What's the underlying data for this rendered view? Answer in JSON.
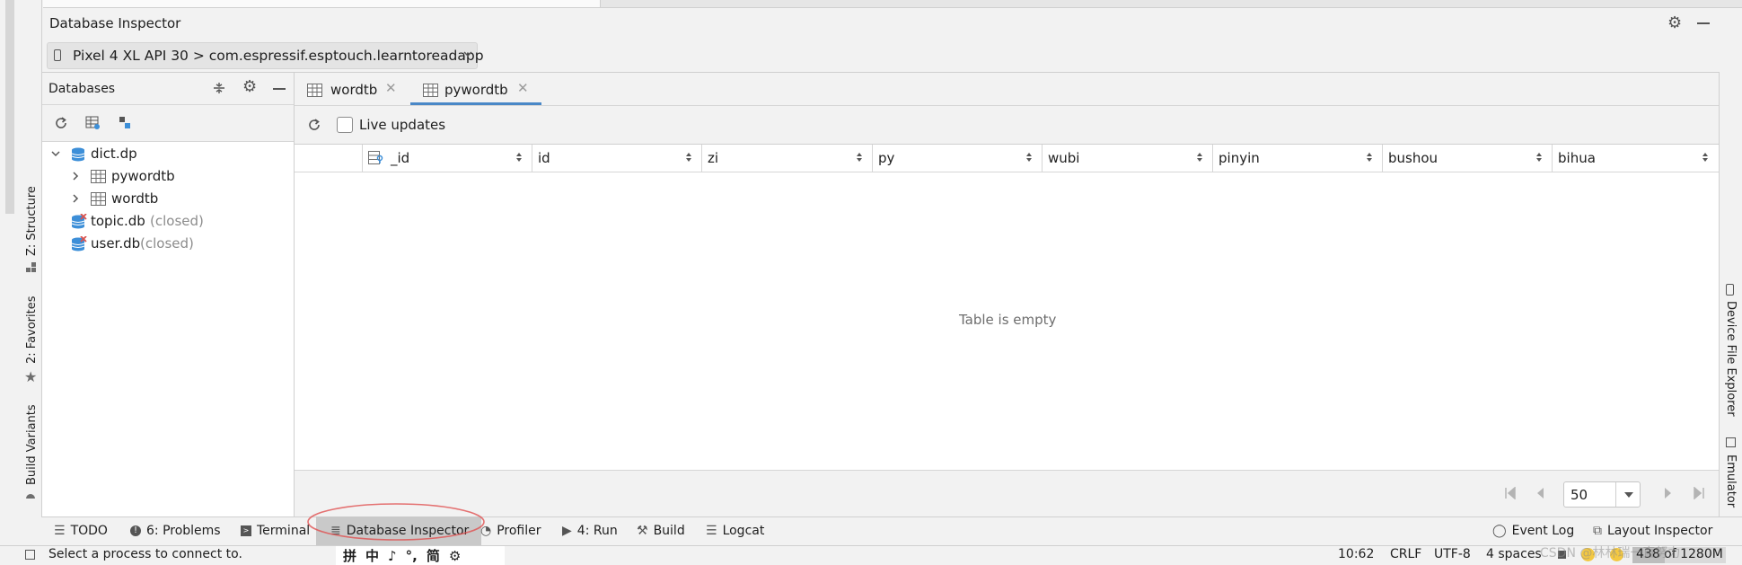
{
  "window": {
    "title": "Database Inspector"
  },
  "process_selector": {
    "value": "Pixel 4 XL API 30 > com.espressif.esptouch.learntoreadapp"
  },
  "databases_panel": {
    "title": "Databases",
    "tree": [
      {
        "label": "dict.dp",
        "status": ""
      },
      {
        "label": "pywordtb",
        "status": ""
      },
      {
        "label": "wordtb",
        "status": ""
      },
      {
        "label": "topic.db",
        "status": "(closed)"
      },
      {
        "label": "user.db",
        "status": "(closed)"
      }
    ]
  },
  "tabs": [
    {
      "label": "wordtb",
      "active": false
    },
    {
      "label": "pywordtb",
      "active": true
    }
  ],
  "table_toolbar": {
    "live_updates_label": "Live updates",
    "live_updates_checked": false
  },
  "table": {
    "columns": [
      "_id",
      "id",
      "zi",
      "py",
      "wubi",
      "pinyin",
      "bushou",
      "bihua"
    ],
    "empty_message": "Table is empty"
  },
  "pagination": {
    "page_size": "50"
  },
  "left_stripe": {
    "structure": "Z: Structure",
    "favorites": "2: Favorites",
    "build_variants": "Build Variants"
  },
  "right_stripe": {
    "device_file_explorer": "Device File Explorer",
    "emulator": "Emulator"
  },
  "bottom_tools": {
    "todo": "TODO",
    "problems": "6: Problems",
    "terminal": "Terminal",
    "database_inspector": "Database Inspector",
    "profiler": "Profiler",
    "run": "4: Run",
    "build": "Build",
    "logcat": "Logcat",
    "event_log": "Event Log",
    "layout_inspector": "Layout Inspector"
  },
  "status_bar": {
    "message": "Select a process to connect to.",
    "position": "10:62",
    "line_sep": "CRLF",
    "encoding": "UTF-8",
    "indent": "4 spaces",
    "memory": "438 of 1280M"
  },
  "ime_bar": {
    "glyphs": [
      "拼",
      "中",
      "♪",
      "°,",
      "简",
      "⚙"
    ]
  },
  "watermark": "CSDN @林林瑞一直努力",
  "colors": {
    "accent": "#4a88c7",
    "db_icon": "#3d8fd8",
    "closed_red": "#d9534f",
    "annotation": "#e05050"
  }
}
